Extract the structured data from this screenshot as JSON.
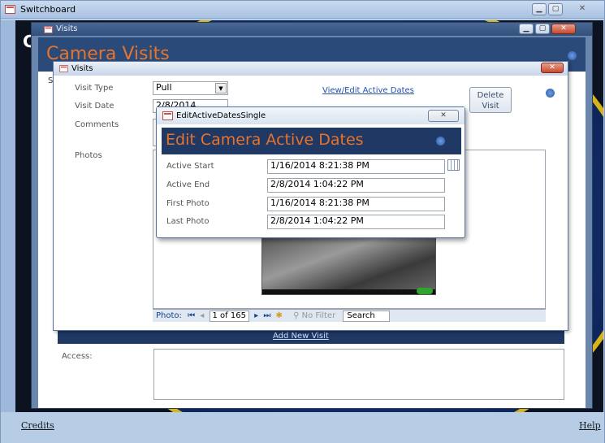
{
  "switchboard": {
    "title": "Switchboard",
    "side_letter": "C",
    "credits": "Credits",
    "help": "Help"
  },
  "visits_outer": {
    "title": "Visits",
    "heading": "Camera Visits",
    "side_letter": "S",
    "add_new_visit": "Add New Visit",
    "access_label": "Access:"
  },
  "visits_inner": {
    "title": "Visits",
    "visit_type": {
      "label": "Visit Type",
      "value": "Pull"
    },
    "visit_date": {
      "label": "Visit Date",
      "value": "2/8/2014"
    },
    "comments_label": "Comments",
    "photos_label": "Photos",
    "view_edit_link": "View/Edit Active Dates",
    "delete_visit": "Delete Visit",
    "nav": {
      "label": "Photo:",
      "record": "1 of 165",
      "filter": "No Filter",
      "search": "Search"
    }
  },
  "dialog": {
    "title": "EditActiveDatesSingle",
    "heading": "Edit Camera Active Dates",
    "fields": [
      {
        "label": "Active Start",
        "value": "1/16/2014 8:21:38 PM"
      },
      {
        "label": "Active End",
        "value": "2/8/2014 1:04:22 PM"
      },
      {
        "label": "First Photo",
        "value": "1/16/2014 8:21:38 PM"
      },
      {
        "label": "Last Photo",
        "value": "2/8/2014 1:04:22 PM"
      }
    ]
  },
  "icons": [
    "app-icon",
    "minimize-icon",
    "restore-icon",
    "close-icon",
    "help-icon",
    "calendar-icon",
    "dropdown-arrow-icon",
    "filter-icon",
    "nav-first-icon",
    "nav-prev-icon",
    "nav-next-icon",
    "nav-last-icon",
    "nav-new-icon"
  ],
  "colors": {
    "heading_orange": "#e8732a",
    "dialog_header_bg": "#1f3864",
    "frame_dark": "#1e2c47"
  }
}
